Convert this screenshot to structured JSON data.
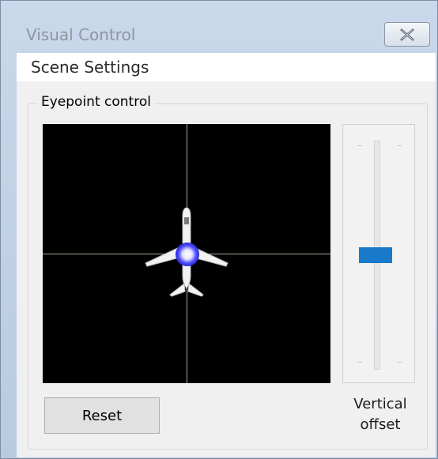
{
  "window": {
    "title": "Visual Control"
  },
  "menu": {
    "items": [
      {
        "label": "Scene Settings"
      }
    ]
  },
  "eyepoint": {
    "group_label": "Eyepoint control",
    "icons": {
      "aircraft": "airplane-icon",
      "eyepoint": "eyepoint-marker-icon",
      "close": "close-icon"
    }
  },
  "vertical_offset": {
    "label_line1": "Vertical",
    "label_line2": "offset",
    "value_fraction": 0.5
  },
  "buttons": {
    "reset_label": "Reset"
  },
  "colors": {
    "slider_thumb": "#1979ca",
    "panel_background": "#000000",
    "crosshair": "#a8a894",
    "eyepoint": "#3a3aff"
  }
}
